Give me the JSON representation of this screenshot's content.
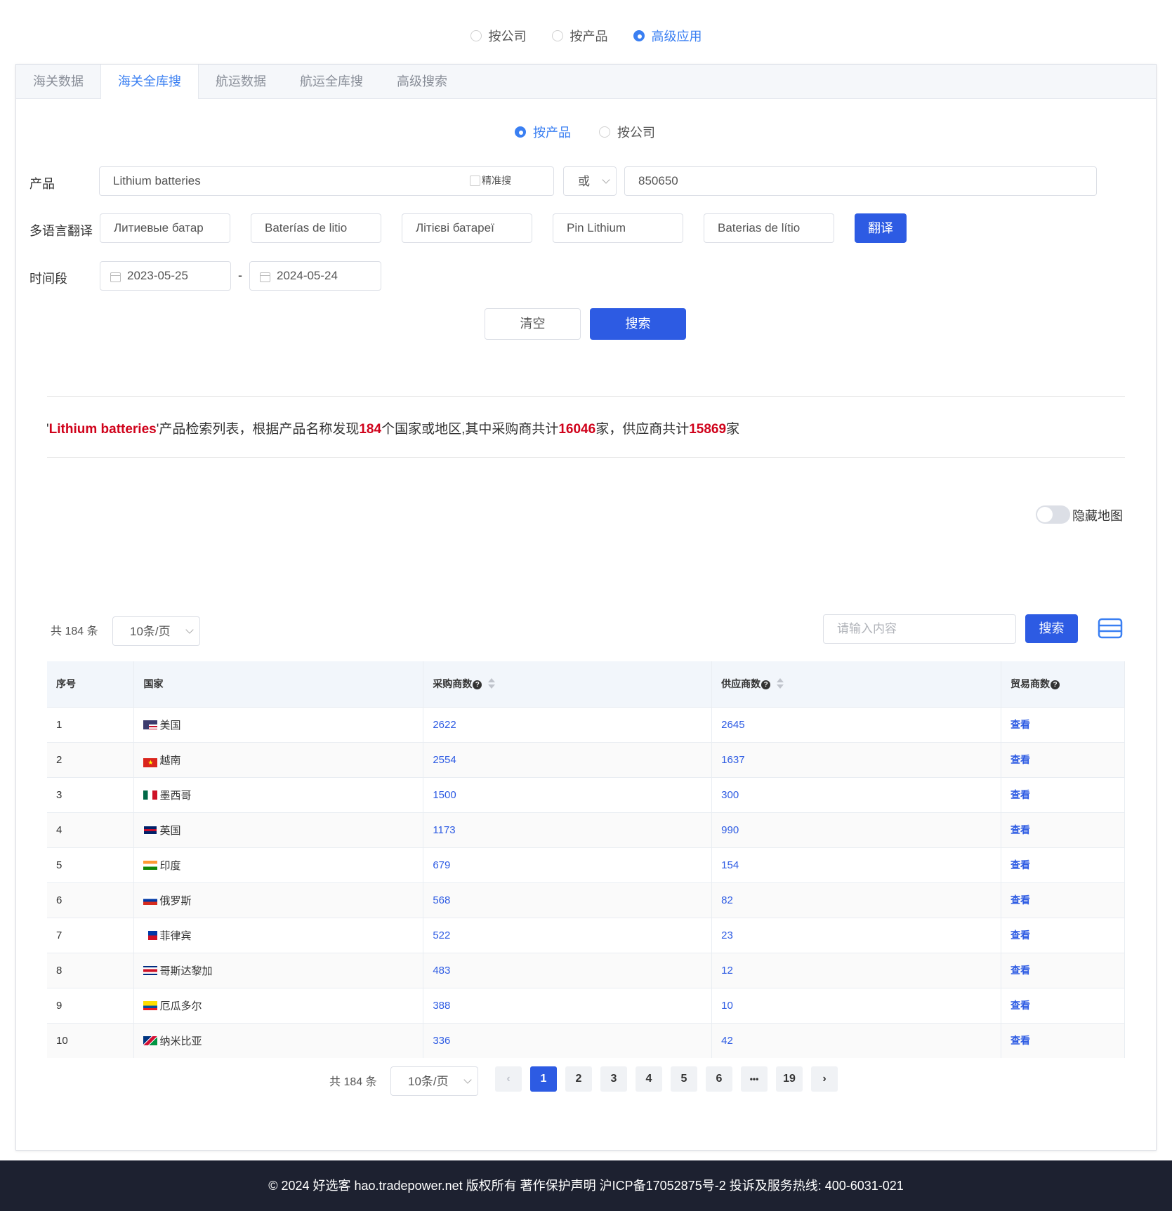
{
  "mode_radios": [
    {
      "label": "按公司",
      "checked": false
    },
    {
      "label": "按产品",
      "checked": false
    },
    {
      "label": "高级应用",
      "checked": true
    }
  ],
  "tabs": [
    "海关数据",
    "海关全库搜",
    "航运数据",
    "航运全库搜",
    "高级搜索"
  ],
  "active_tab": "海关全库搜",
  "search_type": [
    {
      "label": "按产品",
      "checked": true
    },
    {
      "label": "按公司",
      "checked": false
    }
  ],
  "form": {
    "product_label": "产品",
    "product_value": "Lithium batteries",
    "exact_label": "精准搜",
    "logic_value": "或",
    "hs_value": "850650",
    "translate_label": "多语言翻译",
    "translations": [
      "Литиевые батар",
      "Baterías de litio",
      "Літієві батареї",
      "Pin Lithium",
      "Baterias de lítio"
    ],
    "translate_button": "翻译",
    "period_label": "时间段",
    "date_from": "2023-05-25",
    "date_sep": "-",
    "date_to": "2024-05-24",
    "clear_button": "清空",
    "search_button": "搜索"
  },
  "summary": {
    "q_open": "'",
    "keyword": "Lithium batteries",
    "t1": "'产品检索列表，根据产品名称发现",
    "countries": "184",
    "t2": "个国家或地区,其中采购商共计",
    "buyers": "16046",
    "t3": "家，供应商共计",
    "suppliers": "15869",
    "t4": "家"
  },
  "map_toggle": {
    "label": "隐藏地图",
    "on": false
  },
  "table_toolbar": {
    "total": "共 184 条",
    "page_size": "10条/页",
    "search_placeholder": "请输入内容",
    "search_button": "搜索"
  },
  "table": {
    "headers": [
      "序号",
      "国家",
      "采购商数",
      "供应商数",
      "贸易商数"
    ],
    "rows": [
      {
        "no": "1",
        "country": "美国",
        "buyers": "2622",
        "suppliers": "2645",
        "traders": "查看"
      },
      {
        "no": "2",
        "country": "越南",
        "buyers": "2554",
        "suppliers": "1637",
        "traders": "查看"
      },
      {
        "no": "3",
        "country": "墨西哥",
        "buyers": "1500",
        "suppliers": "300",
        "traders": "查看"
      },
      {
        "no": "4",
        "country": "英国",
        "buyers": "1173",
        "suppliers": "990",
        "traders": "查看"
      },
      {
        "no": "5",
        "country": "印度",
        "buyers": "679",
        "suppliers": "154",
        "traders": "查看"
      },
      {
        "no": "6",
        "country": "俄罗斯",
        "buyers": "568",
        "suppliers": "82",
        "traders": "查看"
      },
      {
        "no": "7",
        "country": "菲律宾",
        "buyers": "522",
        "suppliers": "23",
        "traders": "查看"
      },
      {
        "no": "8",
        "country": "哥斯达黎加",
        "buyers": "483",
        "suppliers": "12",
        "traders": "查看"
      },
      {
        "no": "9",
        "country": "厄瓜多尔",
        "buyers": "388",
        "suppliers": "10",
        "traders": "查看"
      },
      {
        "no": "10",
        "country": "纳米比亚",
        "buyers": "336",
        "suppliers": "42",
        "traders": "查看"
      }
    ]
  },
  "pagination": {
    "total": "共 184 条",
    "page_size": "10条/页",
    "pages": [
      "1",
      "2",
      "3",
      "4",
      "5",
      "6",
      "•••",
      "19"
    ],
    "current": "1"
  },
  "footer": "© 2024 好选客 hao.tradepower.net 版权所有 著作保护声明 沪ICP备17052875号-2 投诉及服务热线: 400-6031-021",
  "colors": {
    "accent": "#2d5be3",
    "link": "#3a7ff2",
    "highlight": "#d0021b",
    "footer_bg": "#1d2130"
  }
}
